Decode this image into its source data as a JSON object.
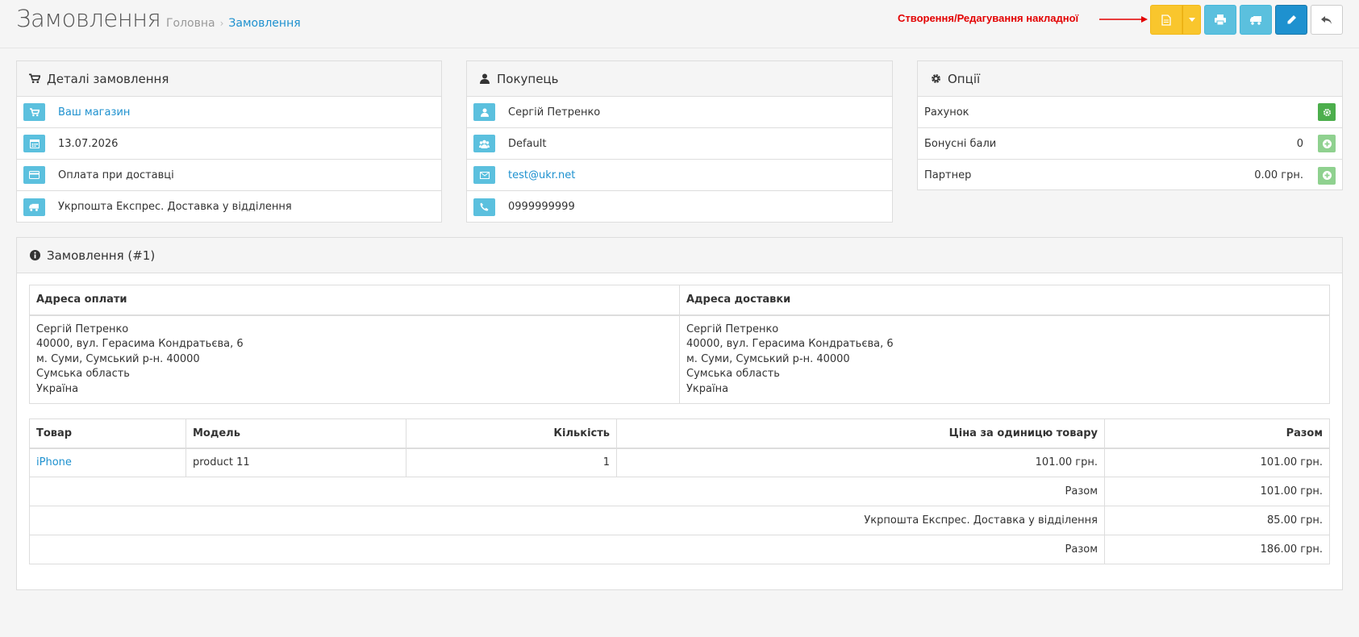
{
  "header": {
    "title": "Замовлення",
    "breadcrumb": [
      "Головна",
      "Замовлення"
    ],
    "annotation": "Створення/Редагування накладної"
  },
  "order_details": {
    "title": "Деталі замовлення",
    "store": "Ваш магазин",
    "date": "13.07.2026",
    "payment": "Оплата при доставці",
    "shipping": "Укрпошта Експрес. Доставка у відділення"
  },
  "customer": {
    "title": "Покупець",
    "name": "Сергій Петренко",
    "group": "Default",
    "email": "test@ukr.net",
    "phone": "0999999999"
  },
  "options": {
    "title": "Опції",
    "invoice_label": "Рахунок",
    "reward_label": "Бонусні бали",
    "reward_value": "0",
    "affiliate_label": "Партнер",
    "affiliate_value": "0.00 грн."
  },
  "order": {
    "title": "Замовлення (#1)",
    "payment_address_label": "Адреса оплати",
    "shipping_address_label": "Адреса доставки",
    "payment_address": [
      "Сергій Петренко",
      "40000, вул. Герасима Кондратьєва, 6",
      "м. Суми, Сумський р-н. 40000",
      "Сумська область",
      "Україна"
    ],
    "shipping_address": [
      "Сергій Петренко",
      "40000, вул. Герасима Кондратьєва, 6",
      "м. Суми, Сумський р-н. 40000",
      "Сумська область",
      "Україна"
    ],
    "columns": [
      "Товар",
      "Модель",
      "Кількість",
      "Ціна за одиницю товару",
      "Разом"
    ],
    "products": [
      {
        "name": "iPhone",
        "model": "product 11",
        "quantity": "1",
        "price": "101.00 грн.",
        "total": "101.00 грн."
      }
    ],
    "totals": [
      {
        "label": "Разом",
        "value": "101.00 грн."
      },
      {
        "label": "Укрпошта Експрес. Доставка у відділення",
        "value": "85.00 грн."
      },
      {
        "label": "Разом",
        "value": "186.00 грн."
      }
    ]
  }
}
